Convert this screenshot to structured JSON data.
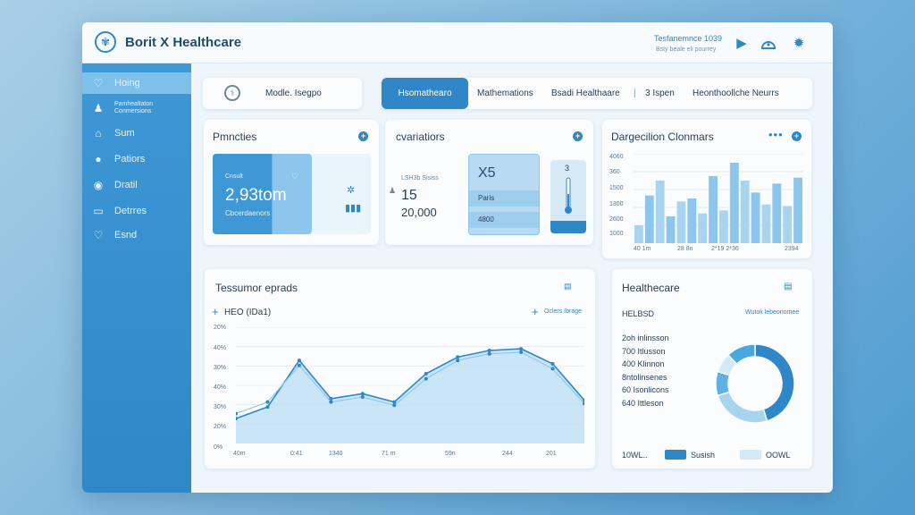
{
  "header": {
    "title": "Borit X Healthcare",
    "status_line": "Tesfanemnce 1039",
    "sub_line": "Bsty beale eli pourrey",
    "icons": [
      "play-icon",
      "bell-icon",
      "gear-icon"
    ]
  },
  "sidebar": {
    "items": [
      {
        "label": "Hoing",
        "icon": "heart-icon"
      },
      {
        "label": "Pamhealtaton Conmersions",
        "icon": "user-icon"
      },
      {
        "label": "Sum",
        "icon": "home-icon"
      },
      {
        "label": "Patiors",
        "icon": "patients-icon"
      },
      {
        "label": "Dratil",
        "icon": "circle-icon"
      },
      {
        "label": "Detrres",
        "icon": "monitor-icon"
      },
      {
        "label": "Esnd",
        "icon": "heart-icon"
      }
    ]
  },
  "search_box": {
    "label": "Modle. Isegpo"
  },
  "tabs": {
    "items": [
      "Hsomathearo",
      "Mathemations",
      "Bsadi Healthaare",
      "3 Ispen",
      "Heonthoollche Neurrs"
    ],
    "separator": "|"
  },
  "card_patients": {
    "title": "Pmncties",
    "tile_label": "Cnsult",
    "tile_value": "2,93tom",
    "tile_sub": "Cbcerdaenors"
  },
  "card_evaluations": {
    "title": "cvariatiors",
    "label": "LSH3b Sisiss",
    "value1": "15",
    "value2": "20,000",
    "mini_value": "X5",
    "mini_row1": "Paris",
    "mini_row2": "4800",
    "gauge_value": "3"
  },
  "card_bar": {
    "title": "Dargecilion Clonmars",
    "y_ticks": [
      "4060",
      "360",
      "1500",
      "1300",
      "2600",
      "1000"
    ],
    "x_ticks": [
      "40 1m",
      "28 8n",
      "2*19 2*36",
      "2394"
    ]
  },
  "card_line": {
    "title": "Tessumor eprads",
    "legend_left": "HEO (IDa1)",
    "legend_right": "Oclers Ibrage",
    "y_ticks": [
      "20%",
      "40%",
      "30%",
      "40%",
      "30%",
      "20%",
      "0%"
    ],
    "x_ticks": [
      "40m",
      "0:41",
      "1340",
      "71 m",
      "59n",
      "244",
      "201"
    ]
  },
  "card_donut": {
    "title": "Healthecare",
    "subtitle": "HELBSD",
    "link": "Wutok lebeonomee",
    "lines": [
      "2oh inlinsson",
      "700 Itlusson",
      "400 Klinnon",
      "8ntolinsenes",
      "60 Isonlicons",
      "640 Ittleson"
    ],
    "footer_left": "10WL..",
    "footer_mid": "Susish",
    "footer_right": "OOWL"
  },
  "chart_data": [
    {
      "type": "bar",
      "title": "Dargecilion Clonmars",
      "values": [
        12,
        32,
        42,
        18,
        28,
        30,
        20,
        45,
        22,
        54,
        42,
        34,
        26,
        40,
        25,
        44
      ],
      "ylim": [
        0,
        60
      ]
    },
    {
      "type": "area",
      "title": "Tessumor eprads",
      "series": [
        {
          "name": "HEO (IDa1)",
          "values": [
            15,
            22,
            50,
            27,
            30,
            25,
            42,
            52,
            56,
            57,
            48,
            26
          ]
        },
        {
          "values": [
            18,
            25,
            47,
            25,
            28,
            23,
            39,
            50,
            54,
            55,
            45,
            24
          ]
        }
      ],
      "ylim": [
        0,
        70
      ]
    },
    {
      "type": "pie",
      "title": "Healthecare",
      "values": [
        45,
        25,
        10,
        8,
        12
      ],
      "colors": [
        "#2f87c8",
        "#a9d4f0",
        "#5fb0e4",
        "#d4e9f7",
        "#4aa8e0"
      ]
    }
  ],
  "colors": {
    "accent": "#2f87c8",
    "light": "#a9d4f0",
    "sidebar": "#3e98d6"
  }
}
